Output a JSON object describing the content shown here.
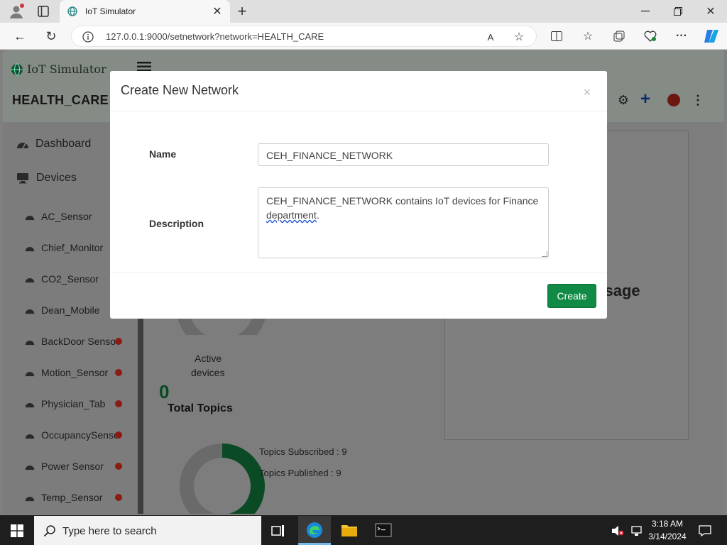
{
  "browser": {
    "tab_title": "IoT Simulator",
    "url": "127.0.0.1:9000/setnetwork?network=HEALTH_CARE",
    "icons": [
      "profile-icon",
      "tab-actions-icon",
      "globe-favicon-icon",
      "close-tab-icon",
      "new-tab-icon",
      "minimize-icon",
      "restore-icon",
      "close-window-icon",
      "back-icon",
      "refresh-icon",
      "site-info-icon",
      "read-aloud-icon",
      "favorite-star-icon",
      "split-screen-icon",
      "favorites-icon",
      "collections-icon",
      "browser-essentials-icon",
      "more-icon",
      "copilot-icon"
    ]
  },
  "app": {
    "brand": "IoT Simulator",
    "network_name": "HEALTH_CARE",
    "sidebar": {
      "nav": [
        {
          "label": "Dashboard",
          "icon": "dashboard-icon"
        },
        {
          "label": "Devices",
          "icon": "monitor-icon"
        }
      ],
      "devices": [
        {
          "label": "AC_Sensor",
          "status": false
        },
        {
          "label": "Chief_Monitor",
          "status": false
        },
        {
          "label": "CO2_Sensor",
          "status": false
        },
        {
          "label": "Dean_Mobile",
          "status": false
        },
        {
          "label": "BackDoor Senso",
          "status": true
        },
        {
          "label": "Motion_Sensor",
          "status": true
        },
        {
          "label": "Physician_Tab",
          "status": true
        },
        {
          "label": "OccupancySense",
          "status": true
        },
        {
          "label": "Power Sensor",
          "status": true
        },
        {
          "label": "Temp_Sensor",
          "status": true
        }
      ]
    },
    "main": {
      "active_devices_label_1": "Active",
      "active_devices_label_2": "devices",
      "total_topics_count": "0",
      "total_topics_label": "Total Topics",
      "topics_subscribed": "Topics Subscribed : 9",
      "topics_published": "Topics Published : 9",
      "message_title_fragment": "essage",
      "topics_donut_fraction_published": 0.5
    }
  },
  "modal": {
    "title": "Create New Network",
    "close": "×",
    "name_label": "Name",
    "name_value": "CEH_FINANCE_NETWORK",
    "description_label": "Description",
    "description_line1": "CEH_FINANCE_NETWORK contains IoT devices for Finance",
    "description_line2_word": "department",
    "description_line2_rest": ".",
    "create_button": "Create"
  },
  "taskbar": {
    "search_placeholder": "Type here to search",
    "time": "3:18 AM",
    "date": "3/14/2024"
  },
  "colors": {
    "create_button": "#118a46",
    "status_dot": "#c0392b",
    "donut_green": "#008a3c",
    "taskbar": "#1e1e1e"
  }
}
